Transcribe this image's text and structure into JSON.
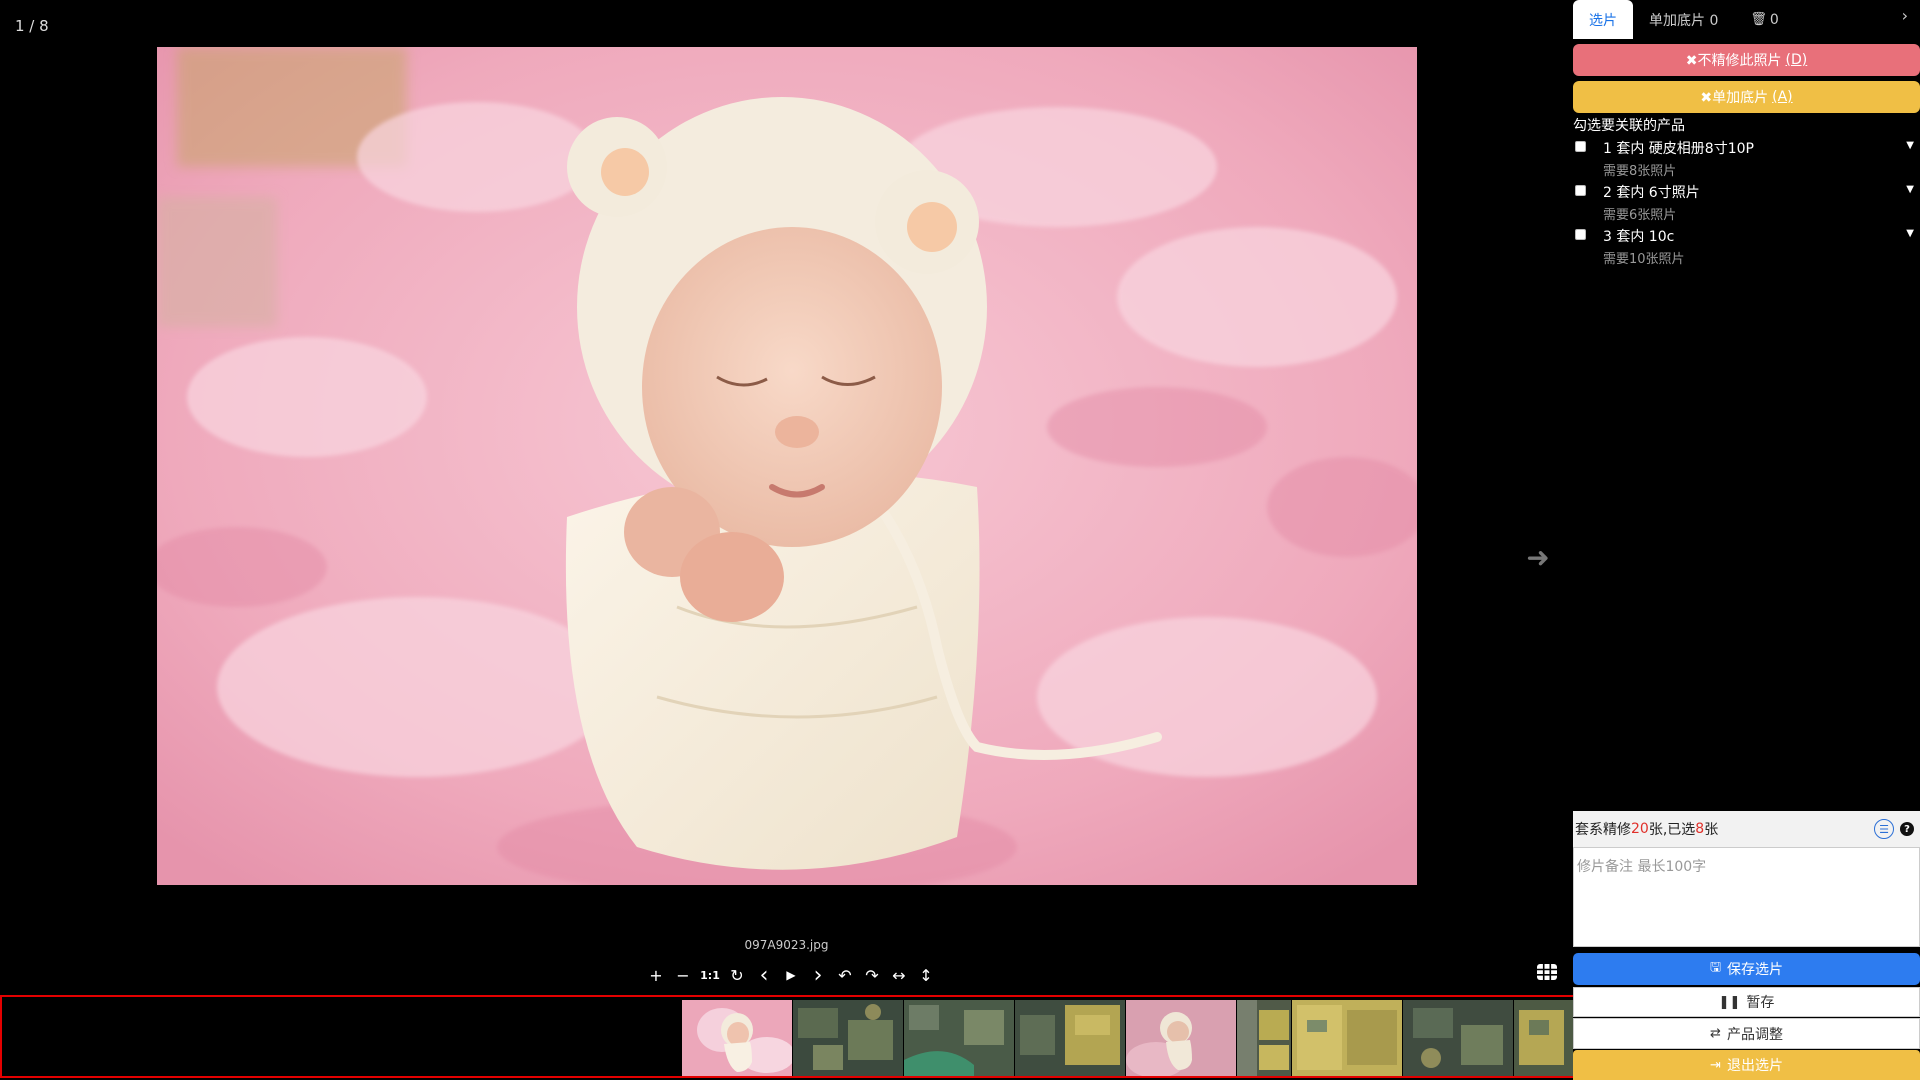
{
  "viewer": {
    "counter": "1 / 8",
    "filename": "097A9023.jpg",
    "next_icon": "arrow-right-icon",
    "toolbar": [
      {
        "name": "zoom-in-icon",
        "glyph": "+"
      },
      {
        "name": "zoom-out-icon",
        "glyph": "−"
      },
      {
        "name": "actual-size-icon",
        "glyph": "1:1"
      },
      {
        "name": "reset-icon",
        "glyph": "↻"
      },
      {
        "name": "prev-icon",
        "glyph": "‹"
      },
      {
        "name": "play-icon",
        "glyph": "▶"
      },
      {
        "name": "next-icon",
        "glyph": "›"
      },
      {
        "name": "rotate-left-icon",
        "glyph": "↶"
      },
      {
        "name": "rotate-right-icon",
        "glyph": "↷"
      },
      {
        "name": "flip-horizontal-icon",
        "glyph": "↔"
      },
      {
        "name": "flip-vertical-icon",
        "glyph": "↕"
      }
    ],
    "grid_icon": "grid-icon"
  },
  "sidebar": {
    "tabs": [
      {
        "label": "选片",
        "active": true,
        "icon": ""
      },
      {
        "label": "单加底片 0",
        "active": false,
        "icon": ""
      },
      {
        "label": "0",
        "active": false,
        "icon": "🗑"
      }
    ],
    "collapse_glyph": "›",
    "no_retouch_label": "✖不精修此照片",
    "no_retouch_shortcut": "(D)",
    "add_single_label": "✖单加底片",
    "add_single_shortcut": "(A)",
    "assoc_title": "勾选要关联的产品",
    "products": [
      {
        "name": "1 套内 硬皮相册8寸10P",
        "need": "需要8张照片"
      },
      {
        "name": "2 套内 6寸照片",
        "need": "需要6张照片"
      },
      {
        "name": "3 套内 10c",
        "need": "需要10张照片"
      }
    ],
    "summary": {
      "prefix": "套系精修 ",
      "total": "20",
      "middle": " 张,已选",
      "selected": "8",
      "suffix": " 张"
    },
    "note_placeholder": "修片备注 最长100字",
    "save_label": "保存选片",
    "pause_label": "暂存",
    "adjust_label": "产品调整",
    "exit_label": "退出选片"
  },
  "colors": {
    "danger": "#e8707a",
    "warning": "#f0bf45",
    "primary": "#2d7cf0",
    "tab_active": "#1a73e8",
    "strip_border": "#e40000"
  }
}
